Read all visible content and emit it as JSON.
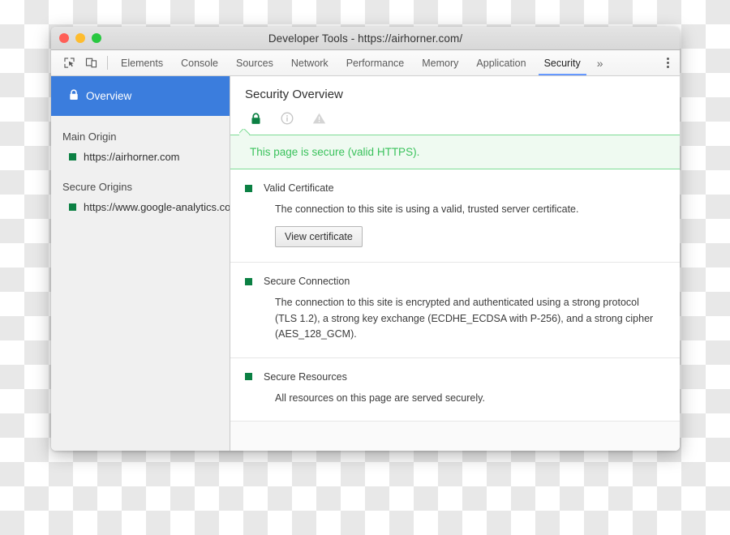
{
  "window": {
    "title": "Developer Tools - https://airhorner.com/",
    "traffic_lights": [
      {
        "name": "close",
        "color": "#ff5f57"
      },
      {
        "name": "minimize",
        "color": "#febc2e"
      },
      {
        "name": "maximize",
        "color": "#28c840"
      }
    ]
  },
  "toolbar": {
    "inspect_icon": "inspect-element-icon",
    "device_icon": "device-toolbar-icon",
    "more_tabs_label": "»",
    "kebab_label": "more-options-icon"
  },
  "tabs": [
    {
      "label": "Elements",
      "active": false
    },
    {
      "label": "Console",
      "active": false
    },
    {
      "label": "Sources",
      "active": false
    },
    {
      "label": "Network",
      "active": false
    },
    {
      "label": "Performance",
      "active": false
    },
    {
      "label": "Memory",
      "active": false
    },
    {
      "label": "Application",
      "active": false
    },
    {
      "label": "Security",
      "active": true
    }
  ],
  "sidebar": {
    "overview": {
      "label": "Overview",
      "icon": "lock-icon",
      "selected": true,
      "background": "#3b7ddd"
    },
    "groups": [
      {
        "title": "Main Origin",
        "origins": [
          {
            "label": "https://airhorner.com",
            "state_color": "#0b8043"
          }
        ]
      },
      {
        "title": "Secure Origins",
        "origins": [
          {
            "label": "https://www.google-analytics.com",
            "state_color": "#0b8043"
          }
        ]
      }
    ]
  },
  "main": {
    "heading": "Security Overview",
    "state_icons": [
      {
        "name": "lock-icon",
        "state": "secure",
        "color": "#0b8043"
      },
      {
        "name": "info-icon",
        "state": "info",
        "color": "#bdbdbd"
      },
      {
        "name": "warning-triangle-icon",
        "state": "warning",
        "color": "#d0d0d0"
      }
    ],
    "summary_banner": {
      "text": "This page is secure (valid HTTPS).",
      "text_color": "#3ac25c",
      "background": "#effaf1",
      "border_color": "#7ddc95"
    },
    "sections": [
      {
        "title": "Valid Certificate",
        "state_color": "#0b8043",
        "body": "The connection to this site is using a valid, trusted server certificate.",
        "button": "View certificate"
      },
      {
        "title": "Secure Connection",
        "state_color": "#0b8043",
        "body": "The connection to this site is encrypted and authenticated using a strong protocol (TLS 1.2), a strong key exchange (ECDHE_ECDSA with P-256), and a strong cipher (AES_128_GCM).",
        "button": null
      },
      {
        "title": "Secure Resources",
        "state_color": "#0b8043",
        "body": "All resources on this page are served securely.",
        "button": null
      }
    ]
  }
}
